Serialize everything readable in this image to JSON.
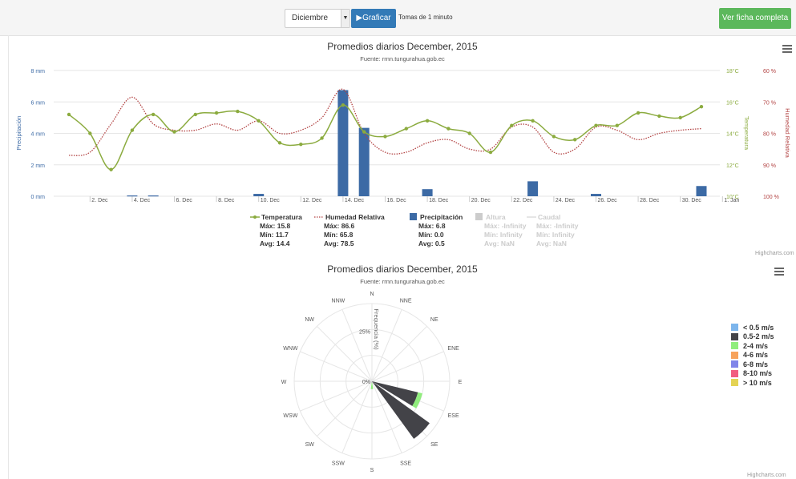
{
  "toolbar": {
    "month_value": "Diciembre",
    "graph_button": "Graficar",
    "sample_text": "Tomas de 1 minuto",
    "full_sheet_button": "Ver ficha completa"
  },
  "credits": "Highcharts.com",
  "colors": {
    "temperature": "#8bab3f",
    "humidity": "#b34444",
    "precipitation": "#3c6aa5",
    "grid": "#e6e6e6"
  },
  "chart_data": [
    {
      "type": "line",
      "title": "Promedios diarios December, 2015",
      "subtitle": "Fuente: rrnn.tungurahua.gob.ec",
      "y_axes": {
        "precipitation": {
          "label": "Precipitación",
          "ticks": [
            "0 mm",
            "2 mm",
            "4 mm",
            "6 mm",
            "8 mm"
          ],
          "range": [
            0,
            8
          ]
        },
        "temperature": {
          "label": "Temperatura",
          "ticks": [
            "10°C",
            "12°C",
            "14°C",
            "16°C",
            "18°C"
          ],
          "range": [
            10,
            18
          ]
        },
        "humidity": {
          "label": "Humedad Relativa",
          "ticks": [
            "100 %",
            "90 %",
            "80 %",
            "70 %",
            "60 %"
          ],
          "range": [
            100,
            60
          ],
          "reversed": true
        }
      },
      "x_ticks": [
        "2. Dec",
        "4. Dec",
        "6. Dec",
        "8. Dec",
        "10. Dec",
        "12. Dec",
        "14. Dec",
        "16. Dec",
        "18. Dec",
        "20. Dec",
        "22. Dec",
        "24. Dec",
        "26. Dec",
        "28. Dec",
        "30. Dec",
        "1. Jan"
      ],
      "series": [
        {
          "name": "Temperatura",
          "kind": "line",
          "x": [
            1,
            2,
            3,
            4,
            5,
            6,
            7,
            8,
            9,
            10,
            11,
            12,
            13,
            14,
            15,
            16,
            17,
            18,
            19,
            20,
            21,
            22,
            23,
            24,
            25,
            26,
            27,
            28,
            29,
            30,
            31
          ],
          "values": [
            15.2,
            14.0,
            11.7,
            14.2,
            15.2,
            14.1,
            15.2,
            15.3,
            15.4,
            14.8,
            13.4,
            13.3,
            13.7,
            15.8,
            14.1,
            13.8,
            14.3,
            14.8,
            14.3,
            14.0,
            12.8,
            14.5,
            14.8,
            13.8,
            13.6,
            14.5,
            14.5,
            15.3,
            15.1,
            15.0,
            15.7
          ],
          "stats": {
            "max": "Máx: 15.8",
            "min": "Mín: 11.7",
            "avg": "Avg: 14.4"
          }
        },
        {
          "name": "Humedad Relativa",
          "kind": "spline-dotted",
          "x": [
            1,
            2,
            3,
            4,
            5,
            6,
            7,
            8,
            9,
            10,
            11,
            12,
            13,
            14,
            15,
            16,
            17,
            18,
            19,
            20,
            21,
            22,
            23,
            24,
            25,
            26,
            27,
            28,
            29,
            30,
            31
          ],
          "values": [
            87,
            86,
            77,
            68.5,
            77,
            79,
            79,
            77,
            79,
            76,
            80,
            79,
            75,
            66,
            80,
            86,
            86,
            83,
            82,
            85,
            85,
            78,
            78,
            86,
            85,
            78,
            79,
            82,
            80,
            79,
            78.5
          ],
          "stats": {
            "max": "Máx: 86.6",
            "min": "Mín: 65.8",
            "avg": "Avg: 78.5"
          }
        },
        {
          "name": "Precipitación",
          "kind": "column",
          "x": [
            4,
            5,
            10,
            14,
            15,
            18,
            23,
            26,
            31
          ],
          "values": [
            0.05,
            0.05,
            0.15,
            6.75,
            4.35,
            0.45,
            0.95,
            0.15,
            0.65
          ],
          "stats": {
            "max": "Máx: 6.8",
            "min": "Mín: 0.0",
            "avg": "Avg: 0.5"
          }
        },
        {
          "name": "Altura",
          "kind": "hidden",
          "values": [],
          "stats": {
            "max": "Máx: -Infinity",
            "min": "Mín: Infinity",
            "avg": "Avg: NaN"
          }
        },
        {
          "name": "Caudal",
          "kind": "hidden",
          "values": [],
          "stats": {
            "max": "Máx: -Infinity",
            "min": "Mín: Infinity",
            "avg": "Avg: NaN"
          }
        }
      ]
    },
    {
      "type": "windrose",
      "title": "Promedios diarios December, 2015",
      "subtitle": "Fuente: rrnn.tungurahua.gob.ec",
      "radial_axis_label": "Frequencia (%)",
      "radial_ticks": [
        "0%",
        "25%"
      ],
      "directions": [
        "N",
        "NNE",
        "NE",
        "ENE",
        "E",
        "ESE",
        "SE",
        "SSE",
        "S",
        "SSW",
        "SW",
        "WSW",
        "W",
        "WNW",
        "NW",
        "NNW"
      ],
      "series": [
        {
          "name": "< 0.5 m/s",
          "color": "#7cb5ec",
          "values": [
            0,
            0,
            0,
            0,
            0,
            0,
            0,
            0,
            0,
            0,
            0,
            0,
            0,
            0,
            0,
            0
          ]
        },
        {
          "name": "0.5-2 m/s",
          "color": "#434348",
          "values": [
            0,
            0,
            0,
            0,
            0,
            36.5,
            55,
            0,
            1,
            0,
            0,
            0,
            0,
            0,
            0,
            0
          ]
        },
        {
          "name": "2-4 m/s",
          "color": "#90ed7d",
          "values": [
            0,
            0,
            0,
            0,
            0,
            3.5,
            0,
            0,
            5,
            0,
            0,
            0,
            0,
            0,
            0,
            0
          ]
        },
        {
          "name": "4-6 m/s",
          "color": "#f7a35c",
          "values": [
            0,
            0,
            0,
            0,
            0,
            0,
            0,
            0,
            0,
            0,
            0,
            0,
            0,
            0,
            0,
            0
          ]
        },
        {
          "name": "6-8 m/s",
          "color": "#8085e9",
          "values": [
            0,
            0,
            0,
            0,
            0,
            0,
            0,
            0,
            0,
            0,
            0,
            0,
            0,
            0,
            0,
            0
          ]
        },
        {
          "name": "8-10 m/s",
          "color": "#f15c80",
          "values": [
            0,
            0,
            0,
            0,
            0,
            0,
            0,
            0,
            0,
            0,
            0,
            0,
            0,
            0,
            0,
            0
          ]
        },
        {
          "name": "> 10 m/s",
          "color": "#e4d354",
          "values": [
            0,
            0,
            0,
            0,
            0,
            0,
            0,
            0,
            0,
            0,
            0,
            0,
            0,
            0,
            0,
            0
          ]
        }
      ]
    }
  ]
}
